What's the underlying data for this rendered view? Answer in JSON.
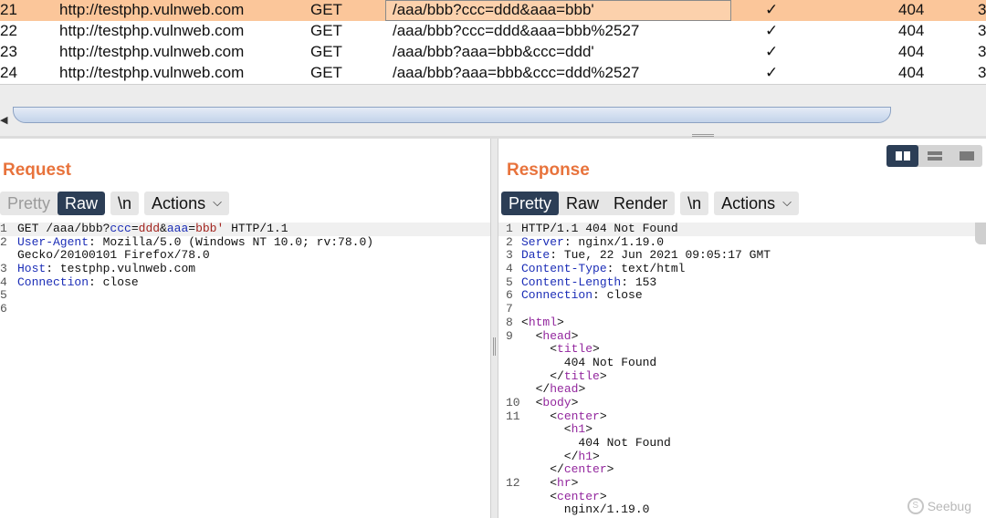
{
  "history": {
    "rows": [
      {
        "num": "21",
        "host": "http://testphp.vulnweb.com",
        "method": "GET",
        "url": "/aaa/bbb?ccc=ddd&aaa=bbb'",
        "check": "✓",
        "status": "404",
        "extra": "3",
        "selected": true
      },
      {
        "num": "22",
        "host": "http://testphp.vulnweb.com",
        "method": "GET",
        "url": "/aaa/bbb?ccc=ddd&aaa=bbb%2527",
        "check": "✓",
        "status": "404",
        "extra": "3"
      },
      {
        "num": "23",
        "host": "http://testphp.vulnweb.com",
        "method": "GET",
        "url": "/aaa/bbb?aaa=bbb&ccc=ddd'",
        "check": "✓",
        "status": "404",
        "extra": "3"
      },
      {
        "num": "24",
        "host": "http://testphp.vulnweb.com",
        "method": "GET",
        "url": "/aaa/bbb?aaa=bbb&ccc=ddd%2527",
        "check": "✓",
        "status": "404",
        "extra": "3"
      }
    ]
  },
  "scroll": {
    "left_arrow": "◀"
  },
  "request": {
    "title": "Request",
    "tabs": {
      "pretty": "Pretty",
      "raw": "Raw",
      "newline": "\\n",
      "actions": "Actions"
    },
    "lines": [
      {
        "n": "1",
        "parts": [
          {
            "t": "GET /aaa/bbb?"
          },
          {
            "t": "ccc",
            "c": "k"
          },
          {
            "t": "="
          },
          {
            "t": "ddd",
            "c": "r"
          },
          {
            "t": "&"
          },
          {
            "t": "aaa",
            "c": "k"
          },
          {
            "t": "="
          },
          {
            "t": "bbb'",
            "c": "r"
          },
          {
            "t": " HTTP/1.1"
          }
        ]
      },
      {
        "n": "2",
        "parts": [
          {
            "t": "User-Agent",
            "c": "k"
          },
          {
            "t": ": Mozilla/5.0 (Windows NT 10.0; rv:78.0)"
          }
        ]
      },
      {
        "n": "",
        "parts": [
          {
            "t": "Gecko/20100101 Firefox/78.0"
          }
        ]
      },
      {
        "n": "3",
        "parts": [
          {
            "t": "Host",
            "c": "k"
          },
          {
            "t": ": testphp.vulnweb.com"
          }
        ]
      },
      {
        "n": "4",
        "parts": [
          {
            "t": "Connection",
            "c": "k"
          },
          {
            "t": ": close"
          }
        ]
      },
      {
        "n": "5",
        "parts": []
      },
      {
        "n": "6",
        "parts": []
      }
    ]
  },
  "response": {
    "title": "Response",
    "tabs": {
      "pretty": "Pretty",
      "raw": "Raw",
      "render": "Render",
      "newline": "\\n",
      "actions": "Actions"
    },
    "lines": [
      {
        "n": "1",
        "parts": [
          {
            "t": "HTTP/1.1 404 Not Found"
          }
        ]
      },
      {
        "n": "2",
        "parts": [
          {
            "t": "Server",
            "c": "k"
          },
          {
            "t": ": nginx/1.19.0"
          }
        ]
      },
      {
        "n": "3",
        "parts": [
          {
            "t": "Date",
            "c": "k"
          },
          {
            "t": ": Tue, 22 Jun 2021 09:05:17 GMT"
          }
        ]
      },
      {
        "n": "4",
        "parts": [
          {
            "t": "Content-Type",
            "c": "k"
          },
          {
            "t": ": text/html"
          }
        ]
      },
      {
        "n": "5",
        "parts": [
          {
            "t": "Content-Length",
            "c": "k"
          },
          {
            "t": ": 153"
          }
        ]
      },
      {
        "n": "6",
        "parts": [
          {
            "t": "Connection",
            "c": "k"
          },
          {
            "t": ": close"
          }
        ]
      },
      {
        "n": "7",
        "parts": []
      },
      {
        "n": "8",
        "parts": [
          {
            "t": "<"
          },
          {
            "t": "html",
            "c": "t"
          },
          {
            "t": ">"
          }
        ]
      },
      {
        "n": "9",
        "parts": [
          {
            "t": "  <"
          },
          {
            "t": "head",
            "c": "t"
          },
          {
            "t": ">"
          }
        ]
      },
      {
        "n": "",
        "parts": [
          {
            "t": "    <"
          },
          {
            "t": "title",
            "c": "t"
          },
          {
            "t": ">"
          }
        ]
      },
      {
        "n": "",
        "parts": [
          {
            "t": "      404 Not Found"
          }
        ]
      },
      {
        "n": "",
        "parts": [
          {
            "t": "    </"
          },
          {
            "t": "title",
            "c": "t"
          },
          {
            "t": ">"
          }
        ]
      },
      {
        "n": "",
        "parts": [
          {
            "t": "  </"
          },
          {
            "t": "head",
            "c": "t"
          },
          {
            "t": ">"
          }
        ]
      },
      {
        "n": "10",
        "parts": [
          {
            "t": "  <"
          },
          {
            "t": "body",
            "c": "t"
          },
          {
            "t": ">"
          }
        ]
      },
      {
        "n": "11",
        "parts": [
          {
            "t": "    <"
          },
          {
            "t": "center",
            "c": "t"
          },
          {
            "t": ">"
          }
        ]
      },
      {
        "n": "",
        "parts": [
          {
            "t": "      <"
          },
          {
            "t": "h1",
            "c": "t"
          },
          {
            "t": ">"
          }
        ]
      },
      {
        "n": "",
        "parts": [
          {
            "t": "        404 Not Found"
          }
        ]
      },
      {
        "n": "",
        "parts": [
          {
            "t": "      </"
          },
          {
            "t": "h1",
            "c": "t"
          },
          {
            "t": ">"
          }
        ]
      },
      {
        "n": "",
        "parts": [
          {
            "t": "    </"
          },
          {
            "t": "center",
            "c": "t"
          },
          {
            "t": ">"
          }
        ]
      },
      {
        "n": "12",
        "parts": [
          {
            "t": "    <"
          },
          {
            "t": "hr",
            "c": "t"
          },
          {
            "t": ">"
          }
        ]
      },
      {
        "n": "",
        "parts": [
          {
            "t": "    <"
          },
          {
            "t": "center",
            "c": "t"
          },
          {
            "t": ">"
          }
        ]
      },
      {
        "n": "",
        "parts": [
          {
            "t": "      nginx/1.19.0"
          }
        ]
      }
    ]
  },
  "layout_toggles": [
    {
      "name": "side-by-side-layout-icon",
      "active": true
    },
    {
      "name": "top-bottom-layout-icon",
      "active": false
    },
    {
      "name": "single-pane-layout-icon",
      "active": false
    }
  ],
  "watermark": {
    "text": "Seebug"
  },
  "colors": {
    "accent": "#e8733c",
    "selected_row": "#fbc69a",
    "active_tab": "#2c3e56"
  }
}
